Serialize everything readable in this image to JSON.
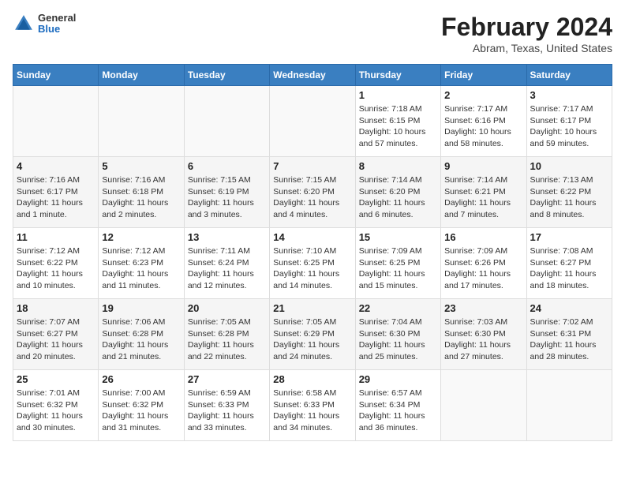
{
  "logo": {
    "general": "General",
    "blue": "Blue"
  },
  "title": "February 2024",
  "subtitle": "Abram, Texas, United States",
  "weekdays": [
    "Sunday",
    "Monday",
    "Tuesday",
    "Wednesday",
    "Thursday",
    "Friday",
    "Saturday"
  ],
  "weeks": [
    [
      {
        "day": "",
        "info": ""
      },
      {
        "day": "",
        "info": ""
      },
      {
        "day": "",
        "info": ""
      },
      {
        "day": "",
        "info": ""
      },
      {
        "day": "1",
        "info": "Sunrise: 7:18 AM\nSunset: 6:15 PM\nDaylight: 10 hours\nand 57 minutes."
      },
      {
        "day": "2",
        "info": "Sunrise: 7:17 AM\nSunset: 6:16 PM\nDaylight: 10 hours\nand 58 minutes."
      },
      {
        "day": "3",
        "info": "Sunrise: 7:17 AM\nSunset: 6:17 PM\nDaylight: 10 hours\nand 59 minutes."
      }
    ],
    [
      {
        "day": "4",
        "info": "Sunrise: 7:16 AM\nSunset: 6:17 PM\nDaylight: 11 hours\nand 1 minute."
      },
      {
        "day": "5",
        "info": "Sunrise: 7:16 AM\nSunset: 6:18 PM\nDaylight: 11 hours\nand 2 minutes."
      },
      {
        "day": "6",
        "info": "Sunrise: 7:15 AM\nSunset: 6:19 PM\nDaylight: 11 hours\nand 3 minutes."
      },
      {
        "day": "7",
        "info": "Sunrise: 7:15 AM\nSunset: 6:20 PM\nDaylight: 11 hours\nand 4 minutes."
      },
      {
        "day": "8",
        "info": "Sunrise: 7:14 AM\nSunset: 6:20 PM\nDaylight: 11 hours\nand 6 minutes."
      },
      {
        "day": "9",
        "info": "Sunrise: 7:14 AM\nSunset: 6:21 PM\nDaylight: 11 hours\nand 7 minutes."
      },
      {
        "day": "10",
        "info": "Sunrise: 7:13 AM\nSunset: 6:22 PM\nDaylight: 11 hours\nand 8 minutes."
      }
    ],
    [
      {
        "day": "11",
        "info": "Sunrise: 7:12 AM\nSunset: 6:22 PM\nDaylight: 11 hours\nand 10 minutes."
      },
      {
        "day": "12",
        "info": "Sunrise: 7:12 AM\nSunset: 6:23 PM\nDaylight: 11 hours\nand 11 minutes."
      },
      {
        "day": "13",
        "info": "Sunrise: 7:11 AM\nSunset: 6:24 PM\nDaylight: 11 hours\nand 12 minutes."
      },
      {
        "day": "14",
        "info": "Sunrise: 7:10 AM\nSunset: 6:25 PM\nDaylight: 11 hours\nand 14 minutes."
      },
      {
        "day": "15",
        "info": "Sunrise: 7:09 AM\nSunset: 6:25 PM\nDaylight: 11 hours\nand 15 minutes."
      },
      {
        "day": "16",
        "info": "Sunrise: 7:09 AM\nSunset: 6:26 PM\nDaylight: 11 hours\nand 17 minutes."
      },
      {
        "day": "17",
        "info": "Sunrise: 7:08 AM\nSunset: 6:27 PM\nDaylight: 11 hours\nand 18 minutes."
      }
    ],
    [
      {
        "day": "18",
        "info": "Sunrise: 7:07 AM\nSunset: 6:27 PM\nDaylight: 11 hours\nand 20 minutes."
      },
      {
        "day": "19",
        "info": "Sunrise: 7:06 AM\nSunset: 6:28 PM\nDaylight: 11 hours\nand 21 minutes."
      },
      {
        "day": "20",
        "info": "Sunrise: 7:05 AM\nSunset: 6:28 PM\nDaylight: 11 hours\nand 22 minutes."
      },
      {
        "day": "21",
        "info": "Sunrise: 7:05 AM\nSunset: 6:29 PM\nDaylight: 11 hours\nand 24 minutes."
      },
      {
        "day": "22",
        "info": "Sunrise: 7:04 AM\nSunset: 6:30 PM\nDaylight: 11 hours\nand 25 minutes."
      },
      {
        "day": "23",
        "info": "Sunrise: 7:03 AM\nSunset: 6:30 PM\nDaylight: 11 hours\nand 27 minutes."
      },
      {
        "day": "24",
        "info": "Sunrise: 7:02 AM\nSunset: 6:31 PM\nDaylight: 11 hours\nand 28 minutes."
      }
    ],
    [
      {
        "day": "25",
        "info": "Sunrise: 7:01 AM\nSunset: 6:32 PM\nDaylight: 11 hours\nand 30 minutes."
      },
      {
        "day": "26",
        "info": "Sunrise: 7:00 AM\nSunset: 6:32 PM\nDaylight: 11 hours\nand 31 minutes."
      },
      {
        "day": "27",
        "info": "Sunrise: 6:59 AM\nSunset: 6:33 PM\nDaylight: 11 hours\nand 33 minutes."
      },
      {
        "day": "28",
        "info": "Sunrise: 6:58 AM\nSunset: 6:33 PM\nDaylight: 11 hours\nand 34 minutes."
      },
      {
        "day": "29",
        "info": "Sunrise: 6:57 AM\nSunset: 6:34 PM\nDaylight: 11 hours\nand 36 minutes."
      },
      {
        "day": "",
        "info": ""
      },
      {
        "day": "",
        "info": ""
      }
    ]
  ]
}
